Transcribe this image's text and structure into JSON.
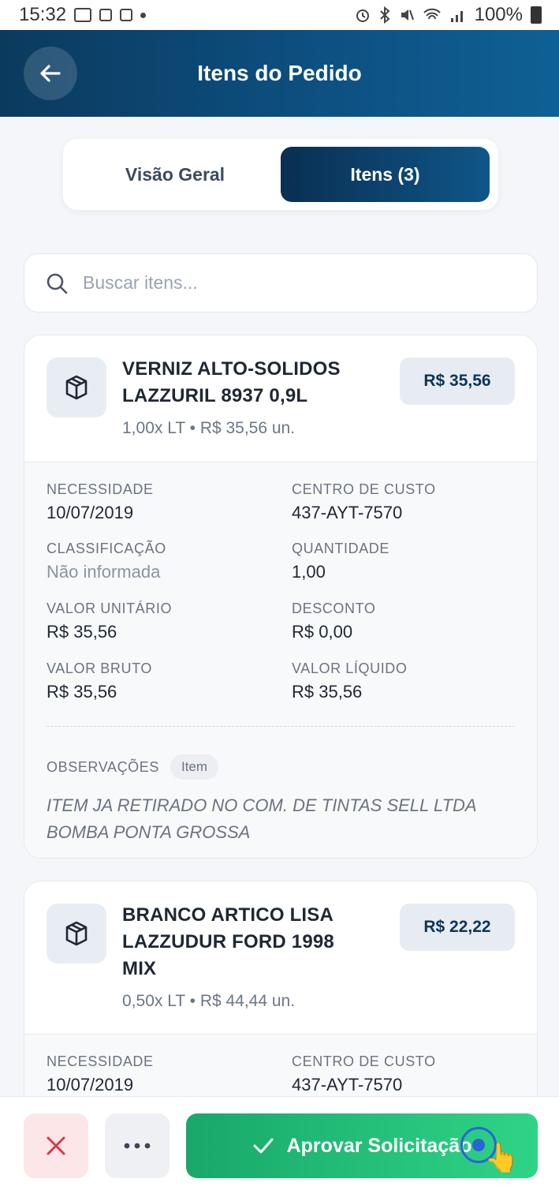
{
  "status_bar": {
    "time": "15:32",
    "battery": "100%"
  },
  "header": {
    "title": "Itens do Pedido",
    "back_icon": "arrow-left-icon"
  },
  "tabs": [
    {
      "label": "Visão Geral",
      "active": false
    },
    {
      "label": "Itens (3)",
      "active": true
    }
  ],
  "search": {
    "placeholder": "Buscar itens..."
  },
  "items": [
    {
      "name_line1": "VERNIZ ALTO-SOLIDOS",
      "name_line2": "LAZZURIL 8937 0,9L",
      "name_line3": "",
      "quantity_text": "1,00x LT",
      "unit_price_text": "R$ 35,56 un.",
      "total": "R$ 35,56",
      "fields": {
        "necessidade_label": "NECESSIDADE",
        "necessidade": "10/07/2019",
        "centro_label": "CENTRO DE CUSTO",
        "centro": "437-AYT-7570",
        "classificacao_label": "CLASSIFICAÇÃO",
        "classificacao": "Não informada",
        "quantidade_label": "QUANTIDADE",
        "quantidade": "1,00",
        "valor_unitario_label": "VALOR UNITÁRIO",
        "valor_unitario": "R$ 35,56",
        "desconto_label": "DESCONTO",
        "desconto": "R$ 0,00",
        "valor_bruto_label": "VALOR BRUTO",
        "valor_bruto": "R$ 35,56",
        "valor_liquido_label": "VALOR LÍQUIDO",
        "valor_liquido": "R$ 35,56"
      },
      "observacoes_label": "OBSERVAÇÕES",
      "observacoes_chip": "Item",
      "observacoes_line1": "ITEM JA RETIRADO NO COM. DE TINTAS SELL LTDA",
      "observacoes_line2": "BOMBA PONTA GROSSA"
    },
    {
      "name_line1": "BRANCO ARTICO LISA",
      "name_line2": "LAZZUDUR FORD 1998",
      "name_line3": "MIX",
      "quantity_text": "0,50x LT",
      "unit_price_text": "R$ 44,44 un.",
      "total": "R$ 22,22",
      "fields": {
        "necessidade_label": "NECESSIDADE",
        "necessidade": "10/07/2019",
        "centro_label": "CENTRO DE CUSTO",
        "centro": "437-AYT-7570"
      }
    }
  ],
  "bottom_bar": {
    "reject_icon": "close-icon",
    "more_icon": "more-horizontal-icon",
    "approve_label": "Aprovar Solicitação",
    "approve_icon": "check-icon"
  },
  "colors": {
    "header_start": "#0b3a5e",
    "header_end": "#0f6095",
    "approve_start": "#18a86a",
    "approve_end": "#2fd487",
    "reject_bg": "#fde6e8",
    "reject_icon": "#d63a48"
  }
}
